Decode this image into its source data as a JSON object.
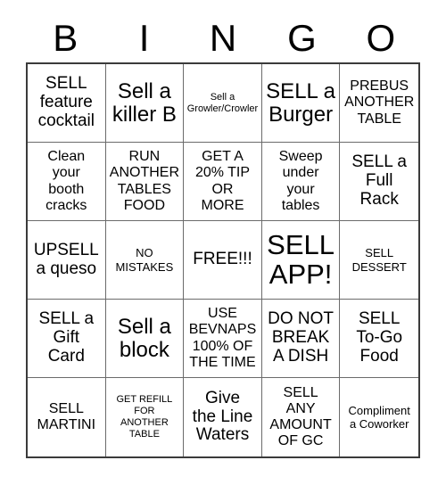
{
  "header": {
    "letters": [
      "B",
      "I",
      "N",
      "G",
      "O"
    ]
  },
  "grid": {
    "rows": 5,
    "columns": 5,
    "cells": [
      {
        "text": "SELL\nfeature\ncocktail",
        "size": "fs-l"
      },
      {
        "text": "Sell a\nkiller B",
        "size": "fs-xl"
      },
      {
        "text": "Sell a\nGrowler/Crowler",
        "size": "fs-xs"
      },
      {
        "text": "SELL a\nBurger",
        "size": "fs-xl"
      },
      {
        "text": "PREBUS\nANOTHER\nTABLE",
        "size": "fs-m"
      },
      {
        "text": "Clean\nyour\nbooth\ncracks",
        "size": "fs-m"
      },
      {
        "text": "RUN\nANOTHER\nTABLES\nFOOD",
        "size": "fs-m"
      },
      {
        "text": "GET A\n20% TIP\nOR\nMORE",
        "size": "fs-m"
      },
      {
        "text": "Sweep\nunder\nyour\ntables",
        "size": "fs-m"
      },
      {
        "text": "SELL a\nFull\nRack",
        "size": "fs-l"
      },
      {
        "text": "UPSELL\na queso",
        "size": "fs-l"
      },
      {
        "text": "NO\nMISTAKES",
        "size": "fs-s"
      },
      {
        "text": "FREE!!!",
        "size": "fs-l"
      },
      {
        "text": "SELL\nAPP!",
        "size": "fs-xxl"
      },
      {
        "text": "SELL\nDESSERT",
        "size": "fs-s"
      },
      {
        "text": "SELL a\nGift\nCard",
        "size": "fs-l"
      },
      {
        "text": "Sell a\nblock",
        "size": "fs-xl"
      },
      {
        "text": "USE\nBEVNAPS\n100% OF\nTHE TIME",
        "size": "fs-m"
      },
      {
        "text": "DO NOT\nBREAK\nA DISH",
        "size": "fs-l"
      },
      {
        "text": "SELL\nTo-Go\nFood",
        "size": "fs-l"
      },
      {
        "text": "SELL\nMARTINI",
        "size": "fs-m"
      },
      {
        "text": "GET REFILL\nFOR\nANOTHER\nTABLE",
        "size": "fs-xs"
      },
      {
        "text": "Give\nthe Line\nWaters",
        "size": "fs-l"
      },
      {
        "text": "SELL\nANY\nAMOUNT\nOF GC",
        "size": "fs-m"
      },
      {
        "text": "Compliment\na Coworker",
        "size": "fs-s"
      }
    ]
  },
  "colors": {
    "background": "#ffffff",
    "text": "#000000",
    "grid_line": "#6b6b6b",
    "outer_border": "#3b3b3b"
  }
}
